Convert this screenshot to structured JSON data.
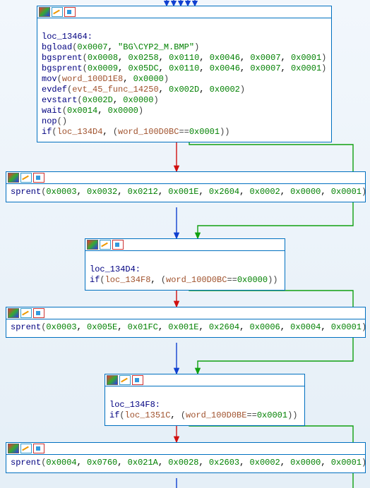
{
  "nodes": {
    "n0": {
      "label": "loc_13464:",
      "lines": [
        {
          "fn": "bgload",
          "args": [
            {
              "t": "hx",
              "v": "0x0007"
            },
            {
              "t": "str",
              "v": "\"BG\\CYP2_M.BMP\""
            }
          ]
        },
        {
          "fn": "bgsprent",
          "args": [
            {
              "t": "hx",
              "v": "0x0008"
            },
            {
              "t": "hx",
              "v": "0x0258"
            },
            {
              "t": "hx",
              "v": "0x0110"
            },
            {
              "t": "hx",
              "v": "0x0046"
            },
            {
              "t": "hx",
              "v": "0x0007"
            },
            {
              "t": "hx",
              "v": "0x0001"
            }
          ]
        },
        {
          "fn": "bgsprent",
          "args": [
            {
              "t": "hx",
              "v": "0x0009"
            },
            {
              "t": "hx",
              "v": "0x05DC"
            },
            {
              "t": "hx",
              "v": "0x0110"
            },
            {
              "t": "hx",
              "v": "0x0046"
            },
            {
              "t": "hx",
              "v": "0x0007"
            },
            {
              "t": "hx",
              "v": "0x0001"
            }
          ]
        },
        {
          "fn": "mov",
          "args": [
            {
              "t": "var",
              "v": "word_100D1E8"
            },
            {
              "t": "hx",
              "v": "0x0000"
            }
          ]
        },
        {
          "fn": "evdef",
          "args": [
            {
              "t": "var",
              "v": "evt_45_func_14250"
            },
            {
              "t": "hx",
              "v": "0x002D"
            },
            {
              "t": "hx",
              "v": "0x0002"
            }
          ]
        },
        {
          "fn": "evstart",
          "args": [
            {
              "t": "hx",
              "v": "0x002D"
            },
            {
              "t": "hx",
              "v": "0x0000"
            }
          ]
        },
        {
          "fn": "wait",
          "args": [
            {
              "t": "hx",
              "v": "0x0014"
            },
            {
              "t": "hx",
              "v": "0x0000"
            }
          ]
        },
        {
          "fn": "nop",
          "args": []
        },
        {
          "fn": "if",
          "args": [
            {
              "t": "var",
              "v": "loc_134D4"
            },
            {
              "t": "pl",
              "v": "("
            },
            {
              "t": "var",
              "v": "word_100D0BC"
            },
            {
              "t": "pl",
              "v": "=="
            },
            {
              "t": "hx",
              "v": "0x0001"
            },
            {
              "t": "pl",
              "v": ")"
            }
          ]
        }
      ]
    },
    "n1": {
      "lines": [
        {
          "fn": "sprent",
          "args": [
            {
              "t": "hx",
              "v": "0x0003"
            },
            {
              "t": "hx",
              "v": "0x0032"
            },
            {
              "t": "hx",
              "v": "0x0212"
            },
            {
              "t": "hx",
              "v": "0x001E"
            },
            {
              "t": "hx",
              "v": "0x2604"
            },
            {
              "t": "hx",
              "v": "0x0002"
            },
            {
              "t": "hx",
              "v": "0x0000"
            },
            {
              "t": "hx",
              "v": "0x0001"
            }
          ]
        }
      ]
    },
    "n2": {
      "label": "loc_134D4:",
      "lines": [
        {
          "fn": "if",
          "args": [
            {
              "t": "var",
              "v": "loc_134F8"
            },
            {
              "t": "pl",
              "v": "("
            },
            {
              "t": "var",
              "v": "word_100D0BC"
            },
            {
              "t": "pl",
              "v": "=="
            },
            {
              "t": "hx",
              "v": "0x0000"
            },
            {
              "t": "pl",
              "v": ")"
            }
          ]
        }
      ]
    },
    "n3": {
      "lines": [
        {
          "fn": "sprent",
          "args": [
            {
              "t": "hx",
              "v": "0x0003"
            },
            {
              "t": "hx",
              "v": "0x005E"
            },
            {
              "t": "hx",
              "v": "0x01FC"
            },
            {
              "t": "hx",
              "v": "0x001E"
            },
            {
              "t": "hx",
              "v": "0x2604"
            },
            {
              "t": "hx",
              "v": "0x0006"
            },
            {
              "t": "hx",
              "v": "0x0004"
            },
            {
              "t": "hx",
              "v": "0x0001"
            }
          ]
        }
      ]
    },
    "n4": {
      "label": "loc_134F8:",
      "lines": [
        {
          "fn": "if",
          "args": [
            {
              "t": "var",
              "v": "loc_1351C"
            },
            {
              "t": "pl",
              "v": "("
            },
            {
              "t": "var",
              "v": "word_100D0BE"
            },
            {
              "t": "pl",
              "v": "=="
            },
            {
              "t": "hx",
              "v": "0x0001"
            },
            {
              "t": "pl",
              "v": ")"
            }
          ]
        }
      ]
    },
    "n5": {
      "lines": [
        {
          "fn": "sprent",
          "args": [
            {
              "t": "hx",
              "v": "0x0004"
            },
            {
              "t": "hx",
              "v": "0x0760"
            },
            {
              "t": "hx",
              "v": "0x021A"
            },
            {
              "t": "hx",
              "v": "0x0028"
            },
            {
              "t": "hx",
              "v": "0x2603"
            },
            {
              "t": "hx",
              "v": "0x0002"
            },
            {
              "t": "hx",
              "v": "0x0000"
            },
            {
              "t": "hx",
              "v": "0x0001"
            }
          ]
        }
      ]
    }
  }
}
